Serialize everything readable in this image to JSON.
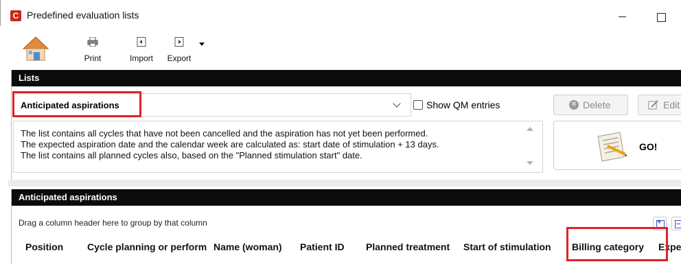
{
  "window": {
    "title": "Predefined evaluation lists",
    "app_icon_glyph": "C",
    "accent_color": "#c8281e"
  },
  "toolbar": {
    "home_icon": "home-icon",
    "buttons": [
      {
        "label": "Print",
        "icon": "printer-icon"
      },
      {
        "label": "Import",
        "icon": "import-icon"
      },
      {
        "label": "Export",
        "icon": "export-icon"
      }
    ]
  },
  "lists_panel": {
    "header": "Lists",
    "selected_list": "Anticipated aspirations",
    "show_qm_label": "Show QM entries",
    "show_qm_checked": false,
    "delete_label": "Delete",
    "edit_label": "Edit",
    "go_label": "GO!",
    "description": [
      "The list contains all cycles that have not been cancelled and the aspiration has not yet been performed.",
      "The expected aspiration date and the calendar week are calculated as: start date of stimulation + 13 days.",
      "The list contains all planned cycles also, based on the \"Planned stimulation start\" date."
    ]
  },
  "table_panel": {
    "header": "Anticipated aspirations",
    "group_hint": "Drag a column header here to group by that column",
    "columns": [
      "Position",
      "Cycle planning or perform",
      "Name (woman)",
      "Patient ID",
      "Planned treatment",
      "Start of stimulation",
      "Billing category",
      "Expe"
    ]
  },
  "highlight_color": "#e0202a"
}
